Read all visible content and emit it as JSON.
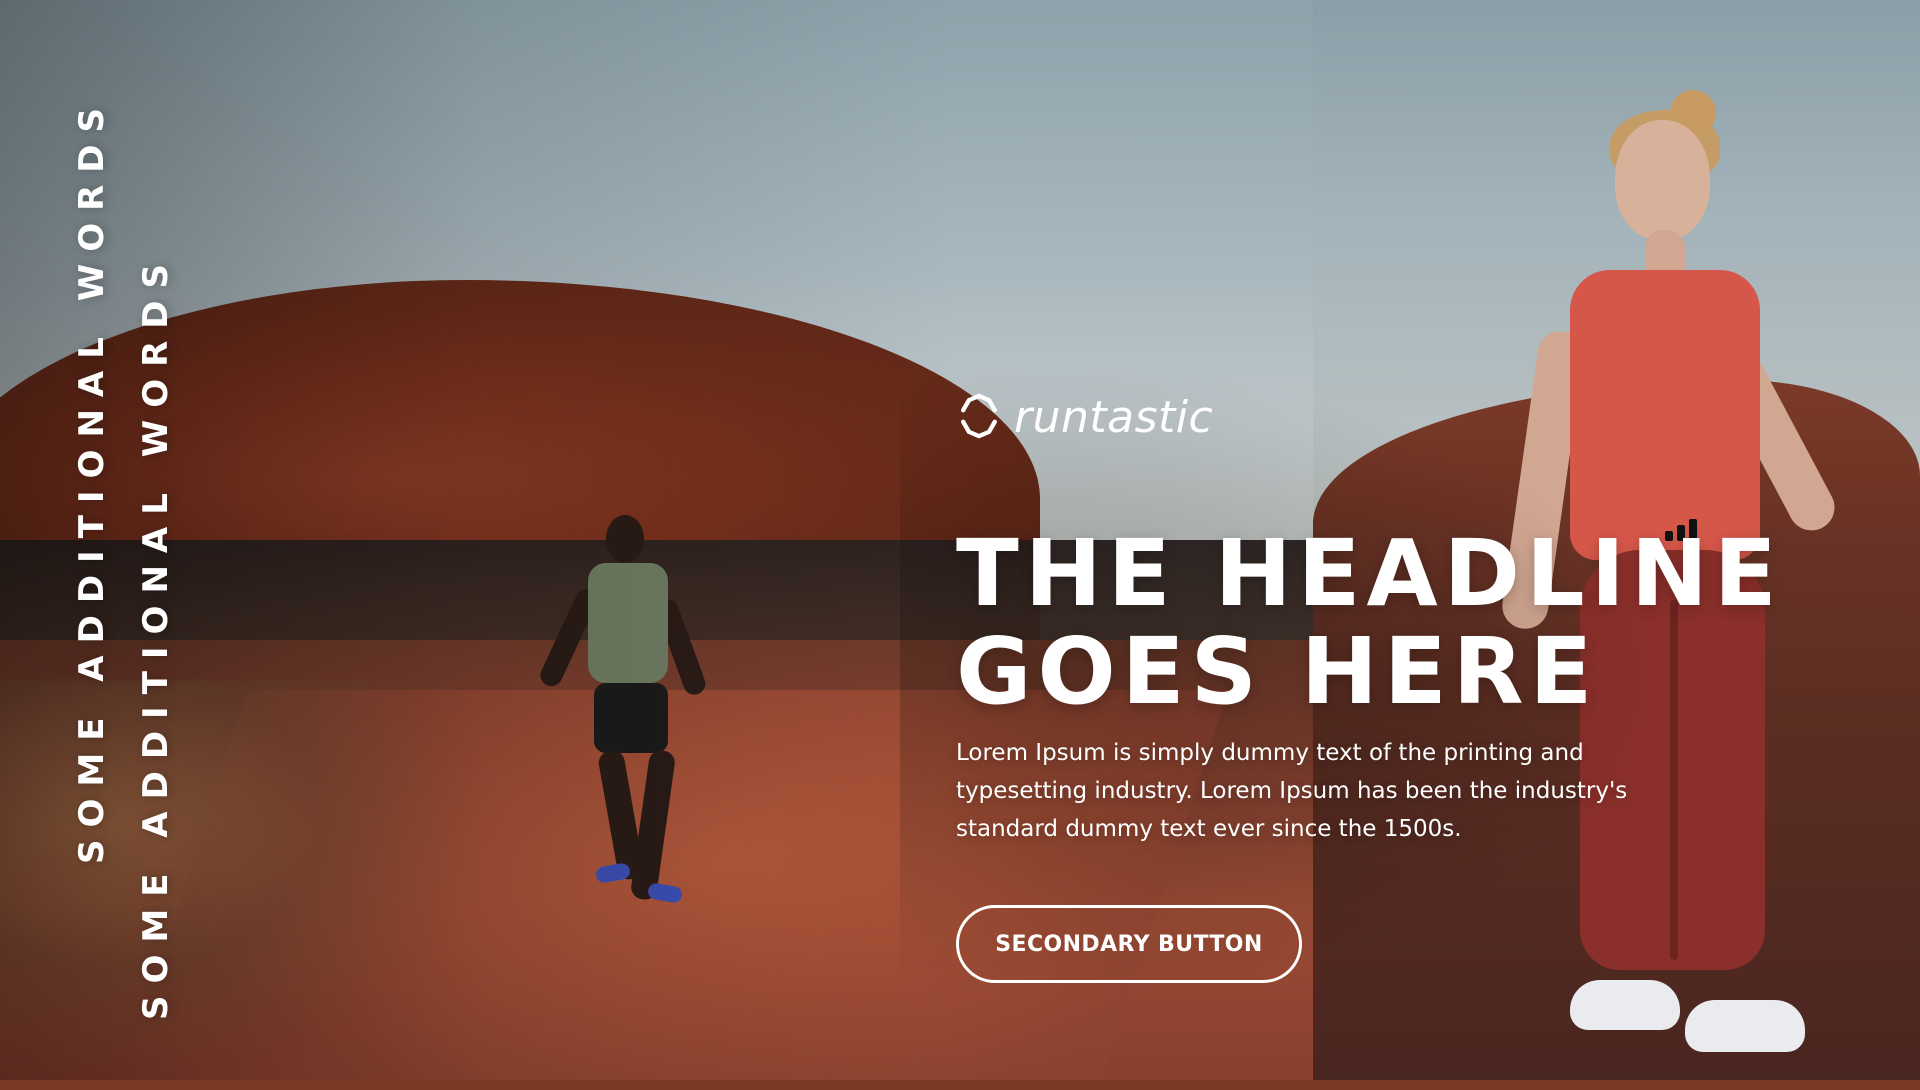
{
  "hero": {
    "vertical_text_1": "SOME ADDITIONAL WORDS",
    "vertical_text_2": "SOME ADDITIONAL WORDS",
    "brand_name": "runtastic",
    "headline_line1": "THE HEADLINE",
    "headline_line2": "GOES HERE",
    "body": "Lorem Ipsum is simply dummy text of the printing and typesetting industry. Lorem Ipsum has been the industry's standard dummy text ever since the 1500s.",
    "button_label": "SECONDARY BUTTON"
  },
  "theme": {
    "text_color": "#ffffff",
    "button_border": "#ffffff"
  },
  "icons": {
    "brand_logo": "runtastic-logo-icon"
  }
}
